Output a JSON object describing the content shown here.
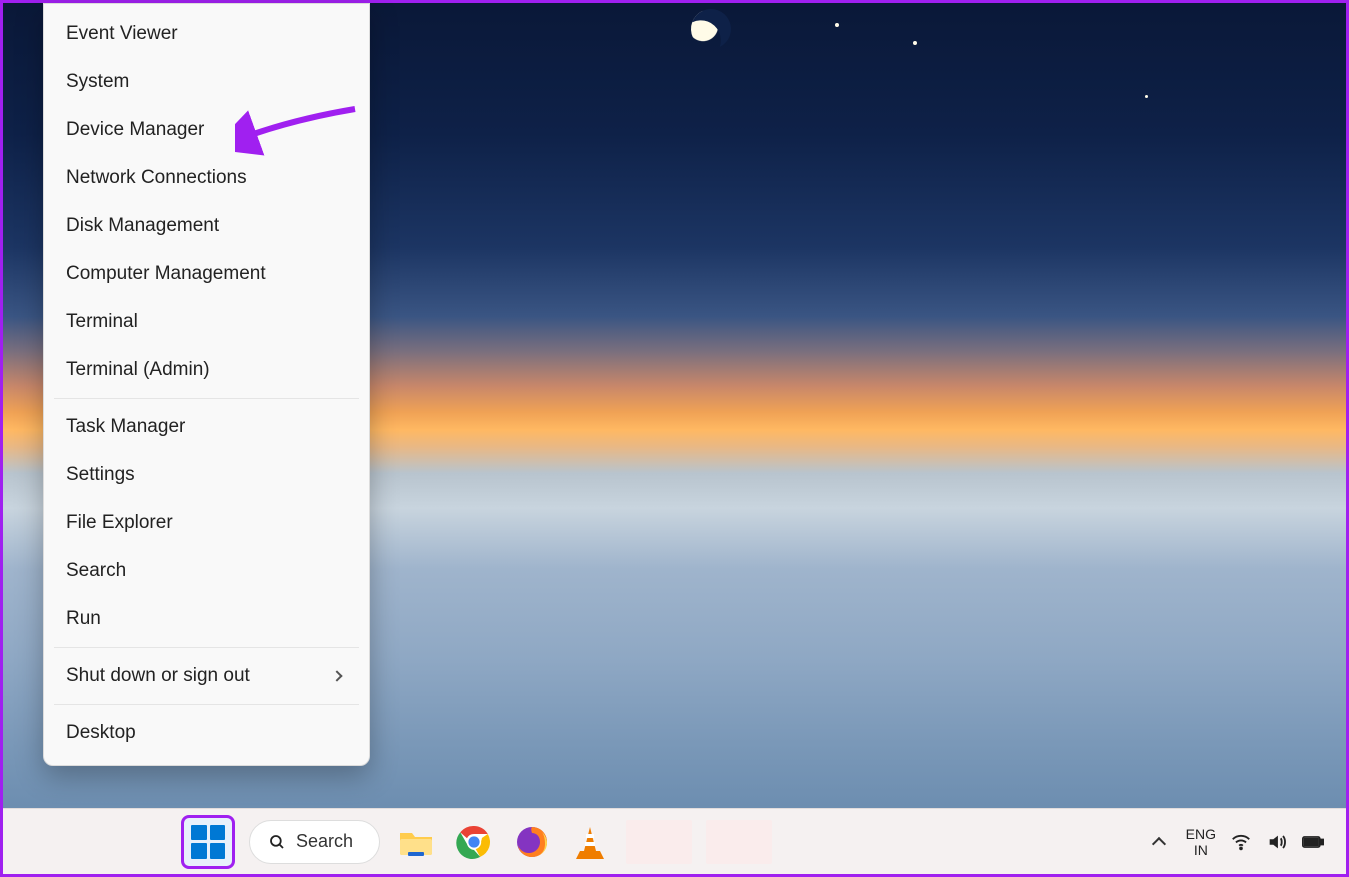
{
  "annotation": {
    "arrow_target": "device-manager",
    "arrow_color": "#a020f0"
  },
  "context_menu": {
    "groups": [
      [
        "Event Viewer",
        "System",
        "Device Manager",
        "Network Connections",
        "Disk Management",
        "Computer Management",
        "Terminal",
        "Terminal (Admin)"
      ],
      [
        "Task Manager",
        "Settings",
        "File Explorer",
        "Search",
        "Run"
      ],
      [
        "Shut down or sign out"
      ],
      [
        "Desktop"
      ]
    ],
    "submenu_items": [
      "Shut down or sign out"
    ]
  },
  "taskbar": {
    "search_label": "Search",
    "pinned": [
      {
        "id": "file-explorer",
        "label": "File Explorer"
      },
      {
        "id": "chrome",
        "label": "Google Chrome"
      },
      {
        "id": "firefox",
        "label": "Firefox"
      },
      {
        "id": "vlc",
        "label": "VLC media player"
      }
    ],
    "lang_top": "ENG",
    "lang_bottom": "IN",
    "tray": [
      "wifi",
      "volume",
      "battery"
    ]
  }
}
